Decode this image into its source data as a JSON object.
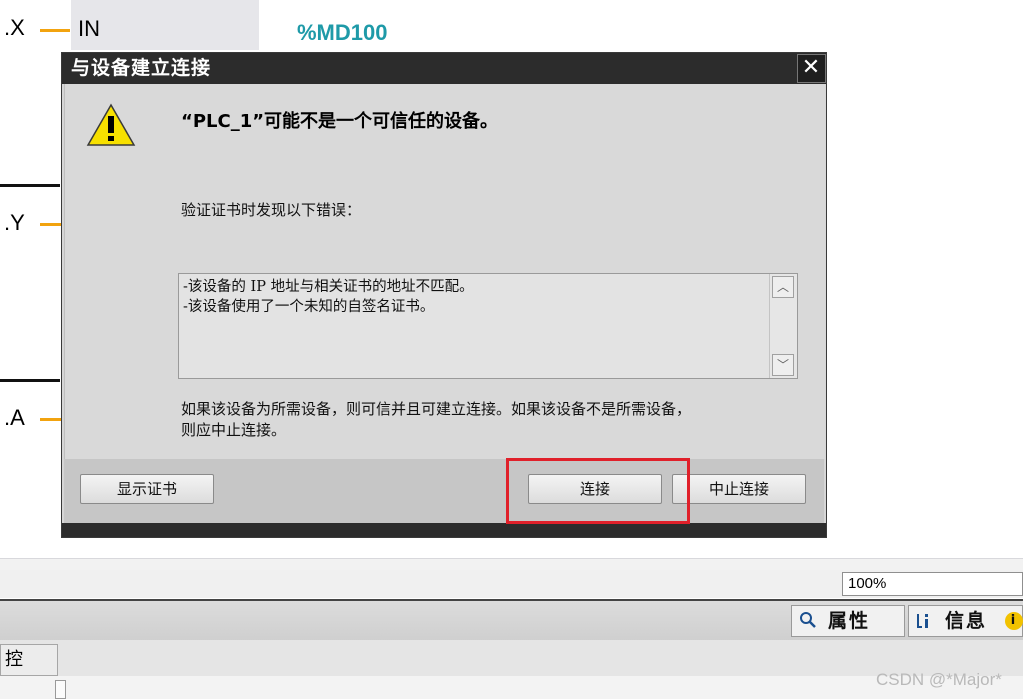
{
  "background": {
    "pins": [
      ".X",
      ".Y",
      ".A"
    ],
    "in_label": "IN",
    "address_label": "%MD100"
  },
  "dialog": {
    "title": "与设备建立连接",
    "close_glyph": "✕",
    "headline": "“PLC_1”可能不是一个可信任的设备。",
    "subtitle": "验证证书时发现以下错误：",
    "errors": [
      "-该设备的 IP 地址与相关证书的地址不匹配。",
      "-该设备使用了一个未知的自签名证书。"
    ],
    "note_line1": "如果该设备为所需设备，则可信并且可建立连接。如果该设备不是所需设备，",
    "note_line2": "则应中止连接。",
    "buttons": {
      "show_certificate": "显示证书",
      "connect": "连接",
      "abort": "中止连接"
    },
    "icon": "warning-icon"
  },
  "ide": {
    "zoom": "100%",
    "tabs": [
      {
        "label": "属性",
        "icon": "magnifier-properties-icon"
      },
      {
        "label": "信息",
        "icon": "info-icon"
      }
    ],
    "bottom_tab": "控",
    "watermark": "CSDN @*Major*"
  },
  "colors": {
    "pin_line": "#f2a30f",
    "address": "#1e9aa8",
    "highlight": "#e0202a",
    "title_bar": "#2c2c2c"
  }
}
